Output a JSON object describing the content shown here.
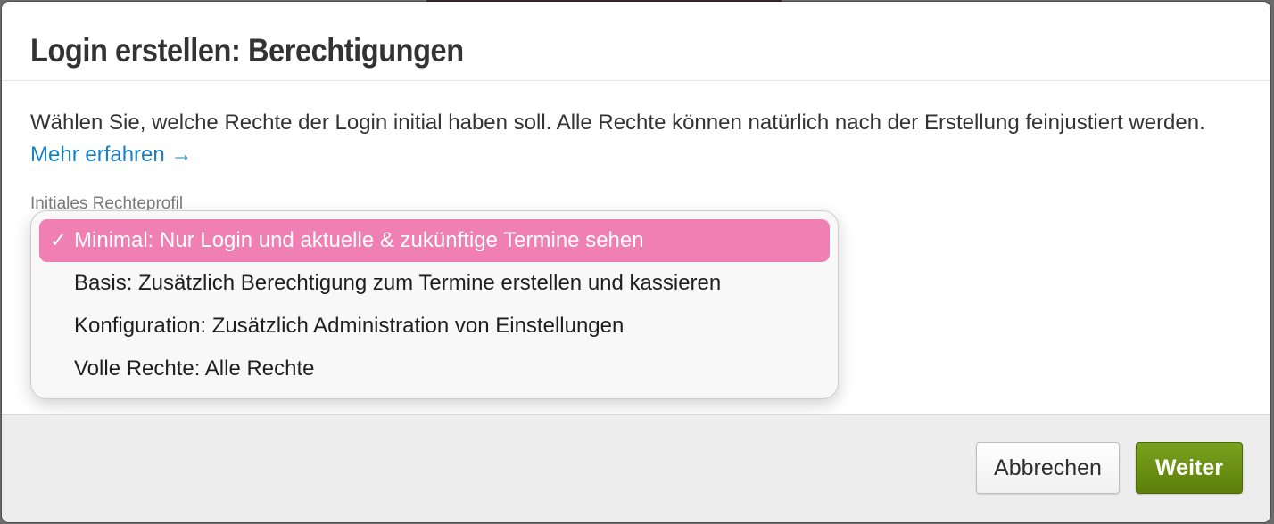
{
  "dialog": {
    "title": "Login erstellen: Berechtigungen",
    "description": "Wählen Sie, welche Rechte der Login initial haben soll. Alle Rechte können natürlich nach der Erstellung feinjustiert werden.",
    "learn_more": "Mehr erfahren →",
    "field_label": "Initiales Rechteprofil",
    "check_glyph": "✓",
    "options": [
      {
        "label": "Minimal: Nur Login und aktuelle & zukünftige Termine sehen",
        "selected": true
      },
      {
        "label": "Basis: Zusätzlich Berechtigung zum Termine erstellen und kassieren",
        "selected": false
      },
      {
        "label": "Konfiguration: Zusätzlich Administration von Einstellungen",
        "selected": false
      },
      {
        "label": "Volle Rechte: Alle Rechte",
        "selected": false
      }
    ],
    "footer": {
      "cancel_label": "Abbrechen",
      "next_label": "Weiter"
    }
  },
  "colors": {
    "selected_option": "#f07fb4",
    "link": "#1a7fc1",
    "primary_button": "#6b9114"
  },
  "icons": {
    "check": "check-icon"
  }
}
